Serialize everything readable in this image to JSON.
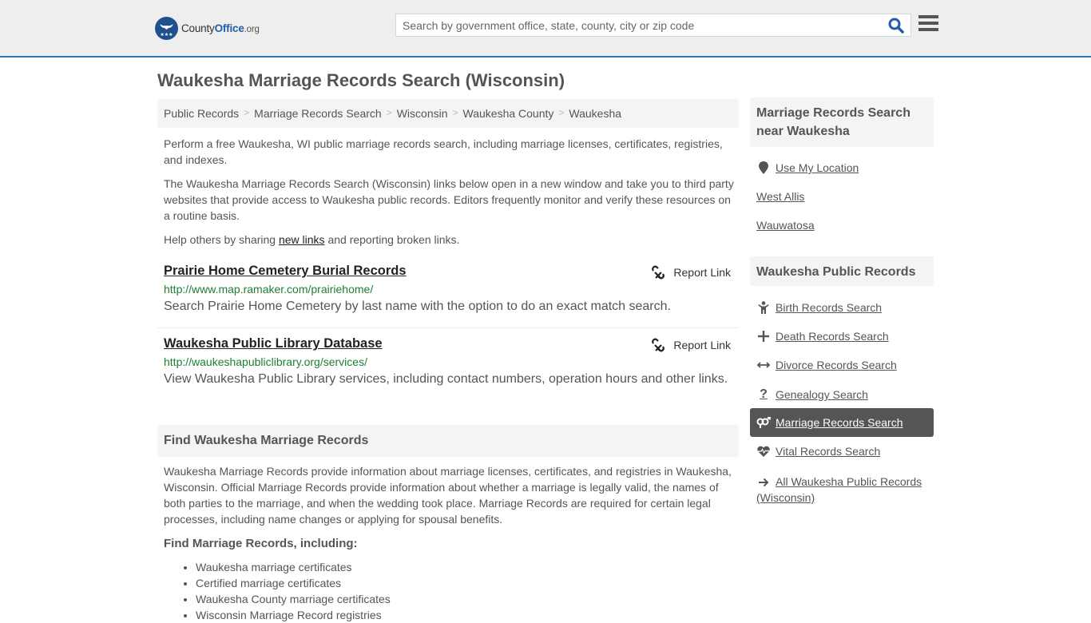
{
  "header": {
    "logo": {
      "name_part1": "County",
      "name_part2": "Office",
      "name_part3": ".org"
    },
    "search": {
      "placeholder": "Search by government office, state, county, city or zip code",
      "value": ""
    },
    "colors": {
      "accent": "#2c73b0",
      "brand_blue": "#1f4f8c",
      "header_bg": "#eeeeee"
    }
  },
  "page": {
    "title": "Waukesha Marriage Records Search (Wisconsin)"
  },
  "breadcrumb": [
    "Public Records",
    "Marriage Records Search",
    "Wisconsin",
    "Waukesha County",
    "Waukesha"
  ],
  "intro": {
    "p1": "Perform a free Waukesha, WI public marriage records search, including marriage licenses, certificates, registries, and indexes.",
    "p2": "The Waukesha Marriage Records Search (Wisconsin) links below open in a new window and take you to third party websites that provide access to Waukesha public records. Editors frequently monitor and verify these resources on a routine basis.",
    "p3_before": "Help others by sharing ",
    "p3_link": "new links",
    "p3_after": " and reporting broken links."
  },
  "results": [
    {
      "title": "Prairie Home Cemetery Burial Records",
      "url": "http://www.map.ramaker.com/prairiehome/",
      "description": "Search Prairie Home Cemetery by last name with the option to do an exact match search.",
      "report_label": "Report Link"
    },
    {
      "title": "Waukesha Public Library Database",
      "url": "http://waukeshapubliclibrary.org/services/",
      "description": "View Waukesha Public Library services, including contact numbers, operation hours and other links.",
      "report_label": "Report Link"
    }
  ],
  "find_section": {
    "heading": "Find Waukesha Marriage Records",
    "body": "Waukesha Marriage Records provide information about marriage licenses, certificates, and registries in Waukesha, Wisconsin. Official Marriage Records provide information about whether a marriage is legally valid, the names of both parties to the marriage, and when the wedding took place. Marriage Records are required for certain legal processes, including name changes or applying for spousal benefits.",
    "subheading": "Find Marriage Records, including:",
    "bullets": [
      "Waukesha marriage certificates",
      "Certified marriage certificates",
      "Waukesha County marriage certificates",
      "Wisconsin Marriage Record registries"
    ]
  },
  "sidebar": {
    "nearby": {
      "heading": "Marriage Records Search near Waukesha",
      "use_location": "Use My Location",
      "cities": [
        "West Allis",
        "Wauwatosa"
      ]
    },
    "public_records": {
      "heading": "Waukesha Public Records",
      "items": [
        {
          "label": "Birth Records Search",
          "icon": "child-icon",
          "active": false
        },
        {
          "label": "Death Records Search",
          "icon": "cross-icon",
          "active": false
        },
        {
          "label": "Divorce Records Search",
          "icon": "arrows-horizontal-icon",
          "active": false
        },
        {
          "label": "Genealogy Search",
          "icon": "question-icon",
          "active": false
        },
        {
          "label": "Marriage Records Search",
          "icon": "gender-symbols-icon",
          "active": true
        },
        {
          "label": "Vital Records Search",
          "icon": "heartbeat-icon",
          "active": false
        },
        {
          "label": "All Waukesha Public Records (Wisconsin)",
          "icon": "arrow-right-icon",
          "active": false
        }
      ]
    }
  }
}
